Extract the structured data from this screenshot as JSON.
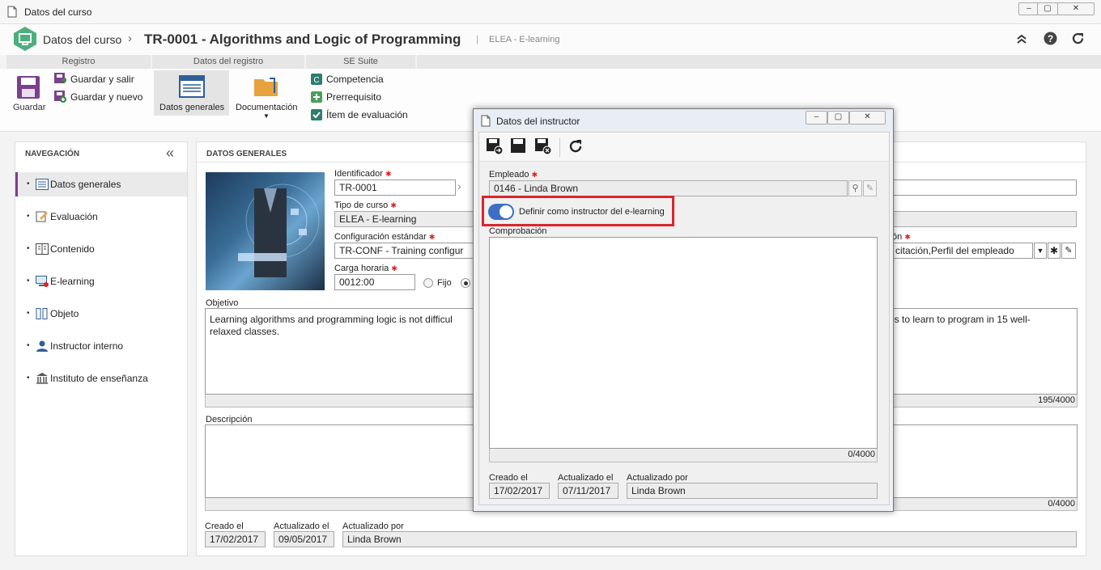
{
  "window": {
    "title": "Datos del curso"
  },
  "header": {
    "module": "Datos del curso",
    "separator": "›",
    "record_title": "TR-0001 - Algorithms and Logic of Programming",
    "divider": "|",
    "context": "ELEA - E-learning"
  },
  "toolbar": {
    "groups": [
      "Registro",
      "Datos del registro",
      "SE Suite"
    ],
    "save_label": "Guardar",
    "save_exit_label": "Guardar y salir",
    "save_new_label": "Guardar y nuevo",
    "general_data_label": "Datos generales",
    "documentation_label": "Documentación",
    "competence_label": "Competencia",
    "prereq_label": "Prerrequisito",
    "eval_item_label": "Ítem de evaluación"
  },
  "nav": {
    "title": "NAVEGACIÓN",
    "collapse": "«",
    "items": [
      {
        "label": "Datos generales"
      },
      {
        "label": "Evaluación"
      },
      {
        "label": "Contenido"
      },
      {
        "label": "E-learning"
      },
      {
        "label": "Objeto"
      },
      {
        "label": "Instructor interno"
      },
      {
        "label": "Instituto de enseñanza"
      }
    ]
  },
  "main": {
    "section_title": "DATOS GENERALES",
    "id_label": "Identificador",
    "id_value": "TR-0001",
    "type_label": "Tipo de curso",
    "type_value": "ELEA - E-learning",
    "config_label": "Configuración estándar",
    "config_value": "TR-CONF - Training configur",
    "config_right_label_tail": "ón",
    "config_right_value": "citación,Perfil del empleado",
    "hours_label": "Carga horaria",
    "hours_value": "0012:00",
    "fixed_label": "Fijo",
    "objective_label": "Objetivo",
    "objective_text_left": "Learning algorithms and programming logic is not difficul",
    "objective_text_left2": "relaxed classes.",
    "objective_text_right": "ps to learn to program in 15 well-",
    "objective_counter": "195/4000",
    "description_label": "Descripción",
    "description_counter": "0/4000",
    "created_label": "Creado el",
    "created_value": "17/02/2017",
    "updated_label": "Actualizado el",
    "updated_value": "09/05/2017",
    "updated_by_label": "Actualizado por",
    "updated_by_value": "Linda Brown"
  },
  "dialog": {
    "title": "Datos del instructor",
    "employee_label": "Empleado",
    "employee_value": "0146 - Linda Brown",
    "toggle_label": "Definir como instructor del e-learning",
    "toggle_on": true,
    "check_label": "Comprobación",
    "check_counter": "0/4000",
    "created_label": "Creado el",
    "created_value": "17/02/2017",
    "updated_label": "Actualizado el",
    "updated_value": "07/11/2017",
    "updated_by_label": "Actualizado por",
    "updated_by_value": "Linda Brown"
  },
  "colors": {
    "accent": "#3b6fc4",
    "highlight": "#d9262c",
    "logo": "#4caf7d"
  }
}
